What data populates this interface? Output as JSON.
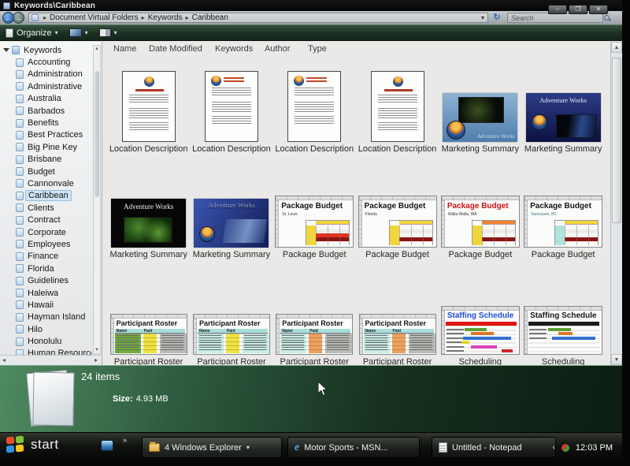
{
  "window": {
    "title": "Keywords\\Caribbean"
  },
  "address_bar": {
    "breadcrumb": [
      "Document Virtual Folders",
      "Keywords",
      "Caribbean"
    ],
    "search_placeholder": "Search"
  },
  "toolbar": {
    "organize_label": "Organize"
  },
  "columns": [
    "Name",
    "Date Modified",
    "Keywords",
    "Author",
    "Type"
  ],
  "sidebar": {
    "root": "Keywords",
    "selected": "Caribbean",
    "items": [
      "Accounting",
      "Administration",
      "Administrative",
      "Australia",
      "Barbados",
      "Benefits",
      "Best Practices",
      "Big Pine Key",
      "Brisbane",
      "Budget",
      "Cannonvale",
      "Caribbean",
      "Clients",
      "Contract",
      "Corporate",
      "Employees",
      "Finance",
      "Florida",
      "Guidelines",
      "Haleiwa",
      "Hawaii",
      "Hayman Island",
      "Hilo",
      "Honolulu",
      "Human Resources"
    ]
  },
  "files": [
    {
      "label": "Location Description",
      "art": "doc",
      "variant": "center"
    },
    {
      "label": "Location Description",
      "art": "doc",
      "variant": "left"
    },
    {
      "label": "Location Description",
      "art": "doc",
      "variant": "left"
    },
    {
      "label": "Location Description",
      "art": "doc",
      "variant": "center"
    },
    {
      "label": "Marketing Summary",
      "art": "slide_sky",
      "title": "Adventure Works"
    },
    {
      "label": "Marketing Summary",
      "art": "slide_navy",
      "title": "Adventure Works"
    },
    {
      "label": "Marketing Summary",
      "art": "slide_black",
      "title": "Adventure Works"
    },
    {
      "label": "Marketing Summary",
      "art": "slide_blue",
      "title": "Adventure Works"
    },
    {
      "label": "Package Budget",
      "art": "budget",
      "title": "Package Budget",
      "subtitle": "St. Louis",
      "title_color": "#161616",
      "subtitle_color": "#333333",
      "accent": "#f0d63a",
      "side": "#f0d63a",
      "red_rows": [
        2,
        3
      ]
    },
    {
      "label": "Package Budget",
      "art": "budget",
      "title": "Package Budget",
      "subtitle": "Florida",
      "title_color": "#161616",
      "subtitle_color": "#333333",
      "accent": "#f0d63a",
      "side": "#f0d63a",
      "red_rows": [
        3
      ]
    },
    {
      "label": "Package Budget",
      "art": "budget",
      "title": "Package Budget",
      "subtitle": "Walla Walla, WA",
      "title_color": "#cc1414",
      "subtitle_color": "#333333",
      "accent": "#ef8330",
      "side": "#f0d63a",
      "red_rows": [
        3
      ]
    },
    {
      "label": "Package Budget",
      "art": "budget",
      "title": "Package Budget",
      "subtitle": "Vancouver, BC",
      "title_color": "#161616",
      "subtitle_color": "#2a7a74",
      "accent": "#f0d63a",
      "side": "#aee4e0",
      "red_rows": [
        3
      ]
    },
    {
      "label": "Participant Roster",
      "art": "roster",
      "title": "Participant Roster",
      "header": [
        "Name",
        "Paid"
      ],
      "cols": [
        "#6fae3a",
        "#f0e23a",
        "#b9bcb6"
      ]
    },
    {
      "label": "Participant Roster",
      "art": "roster",
      "title": "Participant Roster",
      "header": [
        "Name",
        "Paid"
      ],
      "cols": [
        "#c9eee6",
        "#f0e23a",
        "#c9eee6"
      ]
    },
    {
      "label": "Participant Roster",
      "art": "roster",
      "title": "Participant Roster",
      "header": [
        "Name",
        "Paid"
      ],
      "cols": [
        "#c9eee6",
        "#f0a05a",
        "#b9bcb6"
      ]
    },
    {
      "label": "Participant Roster",
      "art": "roster",
      "title": "Participant Roster",
      "header": [
        "Name",
        "Paid"
      ],
      "cols": [
        "#c9eee6",
        "#f0a05a",
        "#b9bcb6"
      ]
    },
    {
      "label": "Scheduling",
      "art": "gantt",
      "title": "Staffing Schedule",
      "title_color": "#1f4fd8",
      "header_bg": "#e01410",
      "bars": [
        [
          30,
          28,
          "#5aa12f"
        ],
        [
          38,
          30,
          "#e07820"
        ],
        [
          28,
          62,
          "#2e6fd8"
        ],
        [
          26,
          10,
          "#e8e02a"
        ],
        [
          38,
          34,
          "#e040c0"
        ],
        [
          78,
          14,
          "#d82020"
        ]
      ]
    },
    {
      "label": "Scheduling",
      "art": "gantt",
      "title": "Staffing Schedule",
      "title_color": "#161616",
      "header_bg": "#1a1a1a",
      "bars": [
        [
          30,
          30,
          "#5aa12f"
        ],
        [
          44,
          18,
          "#e07820"
        ],
        [
          36,
          56,
          "#2e6fd8"
        ]
      ]
    }
  ],
  "details": {
    "count": "24 items",
    "size_label": "Size:",
    "size_value": "4.93 MB"
  },
  "taskbar": {
    "start_label": "start",
    "buttons": [
      {
        "label": "4 Windows Explorer",
        "icon": "folder",
        "grouped": true,
        "active": true
      },
      {
        "label": "Motor Sports - MSN...",
        "icon": "ie",
        "grouped": false,
        "active": false
      },
      {
        "label": "Untitled - Notepad",
        "icon": "notepad",
        "grouped": false,
        "active": false
      }
    ],
    "clock": "12:03 PM"
  },
  "icons": {
    "caret_down": "▾",
    "back_arrow": "←",
    "forward_arrow": "→",
    "refresh": "↻",
    "breadcrumb_sep": "▸",
    "chevron_more": "»",
    "chevron_tray": "‹",
    "scroll_up": "▲",
    "scroll_down": "▼",
    "scroll_left": "◂",
    "scroll_right": "▸",
    "minimize": "–",
    "maximize": "❐",
    "close": "✕"
  },
  "theme": {
    "toolbar_green": "#1b2f22",
    "details_green": "#2f5c40",
    "selection_blue": "#cfe4f6",
    "taskbar_black": "#101310"
  }
}
